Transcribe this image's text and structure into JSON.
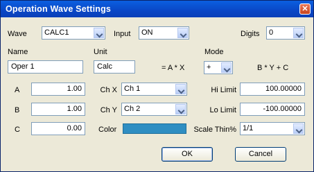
{
  "window": {
    "title": "Operation Wave Settings"
  },
  "row1": {
    "wave_label": "Wave",
    "wave_value": "CALC1",
    "input_label": "Input",
    "input_value": "ON",
    "digits_label": "Digits",
    "digits_value": "0"
  },
  "row2": {
    "name_label": "Name",
    "name_value": "Oper 1",
    "unit_label": "Unit",
    "unit_value": "Calc",
    "formula1": "= A * X",
    "mode_label": "Mode",
    "mode_value": "+",
    "formula2": "B * Y + C"
  },
  "params": {
    "a_label": "A",
    "a_value": "1.00",
    "b_label": "B",
    "b_value": "1.00",
    "c_label": "C",
    "c_value": "0.00",
    "chx_label": "Ch X",
    "chx_value": "Ch 1",
    "chy_label": "Ch Y",
    "chy_value": "Ch 2",
    "color_label": "Color",
    "color": "#2f8ec2",
    "hi_label": "Hi Limit",
    "hi_value": "100.00000",
    "lo_label": "Lo Limit",
    "lo_value": "-100.00000",
    "thin_label": "Scale Thin%",
    "thin_value": "1/1"
  },
  "buttons": {
    "ok": "OK",
    "cancel": "Cancel"
  }
}
